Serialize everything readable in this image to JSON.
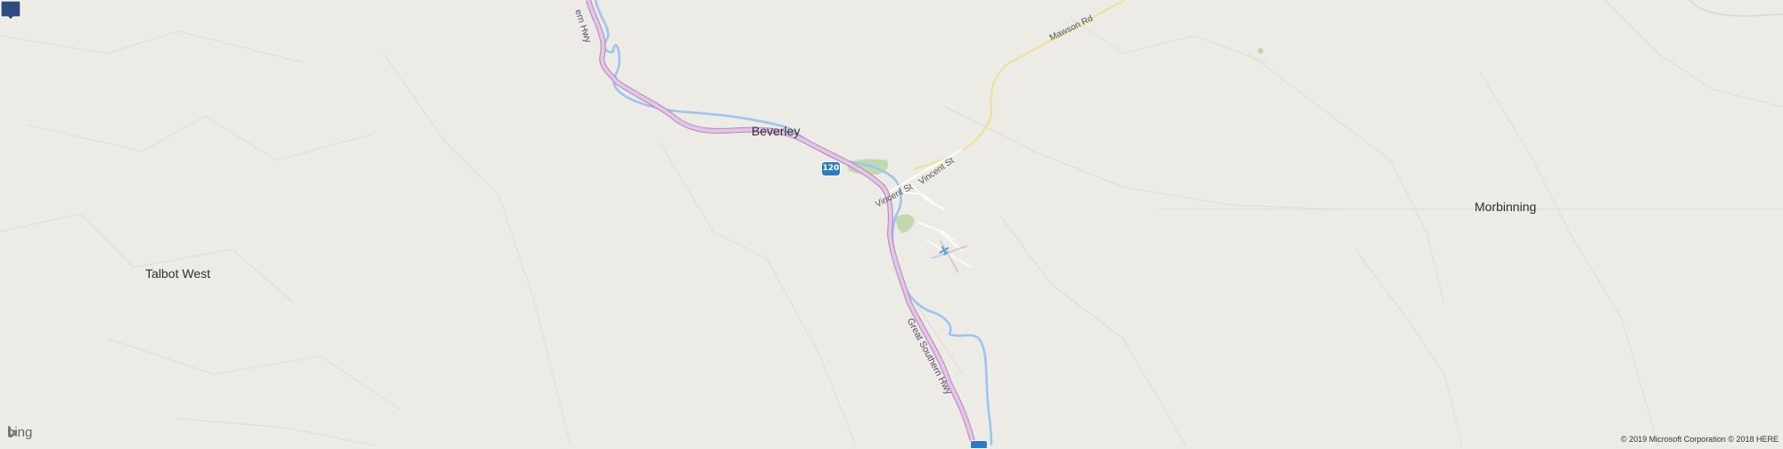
{
  "map": {
    "places": {
      "beverley": "Beverley",
      "talbot_west": "Talbot West",
      "morbinning": "Morbinning"
    },
    "roads": {
      "great_southern_hwy": "Great Southern Hwy",
      "great_southern_hwy_top": "ern Hwy",
      "vincent_st_1": "Vincent St",
      "vincent_st_2": "Vincent St",
      "mawson_rd": "Mawson Rd"
    },
    "route_shield": "120",
    "colors": {
      "background": "#ecebe6",
      "highway": "#d4a3d6",
      "river": "#9cc4ef",
      "minor_road": "#f4e9a6",
      "park": "#b9d6a4",
      "pin": "#2e4b82",
      "shield": "#2b7bc6"
    },
    "icons": [
      "airport-icon",
      "location-pin-icon",
      "bing-logo-icon"
    ]
  },
  "attribution": {
    "brand": "bing",
    "copyright": "© 2019 Microsoft Corporation © 2018 HERE"
  }
}
